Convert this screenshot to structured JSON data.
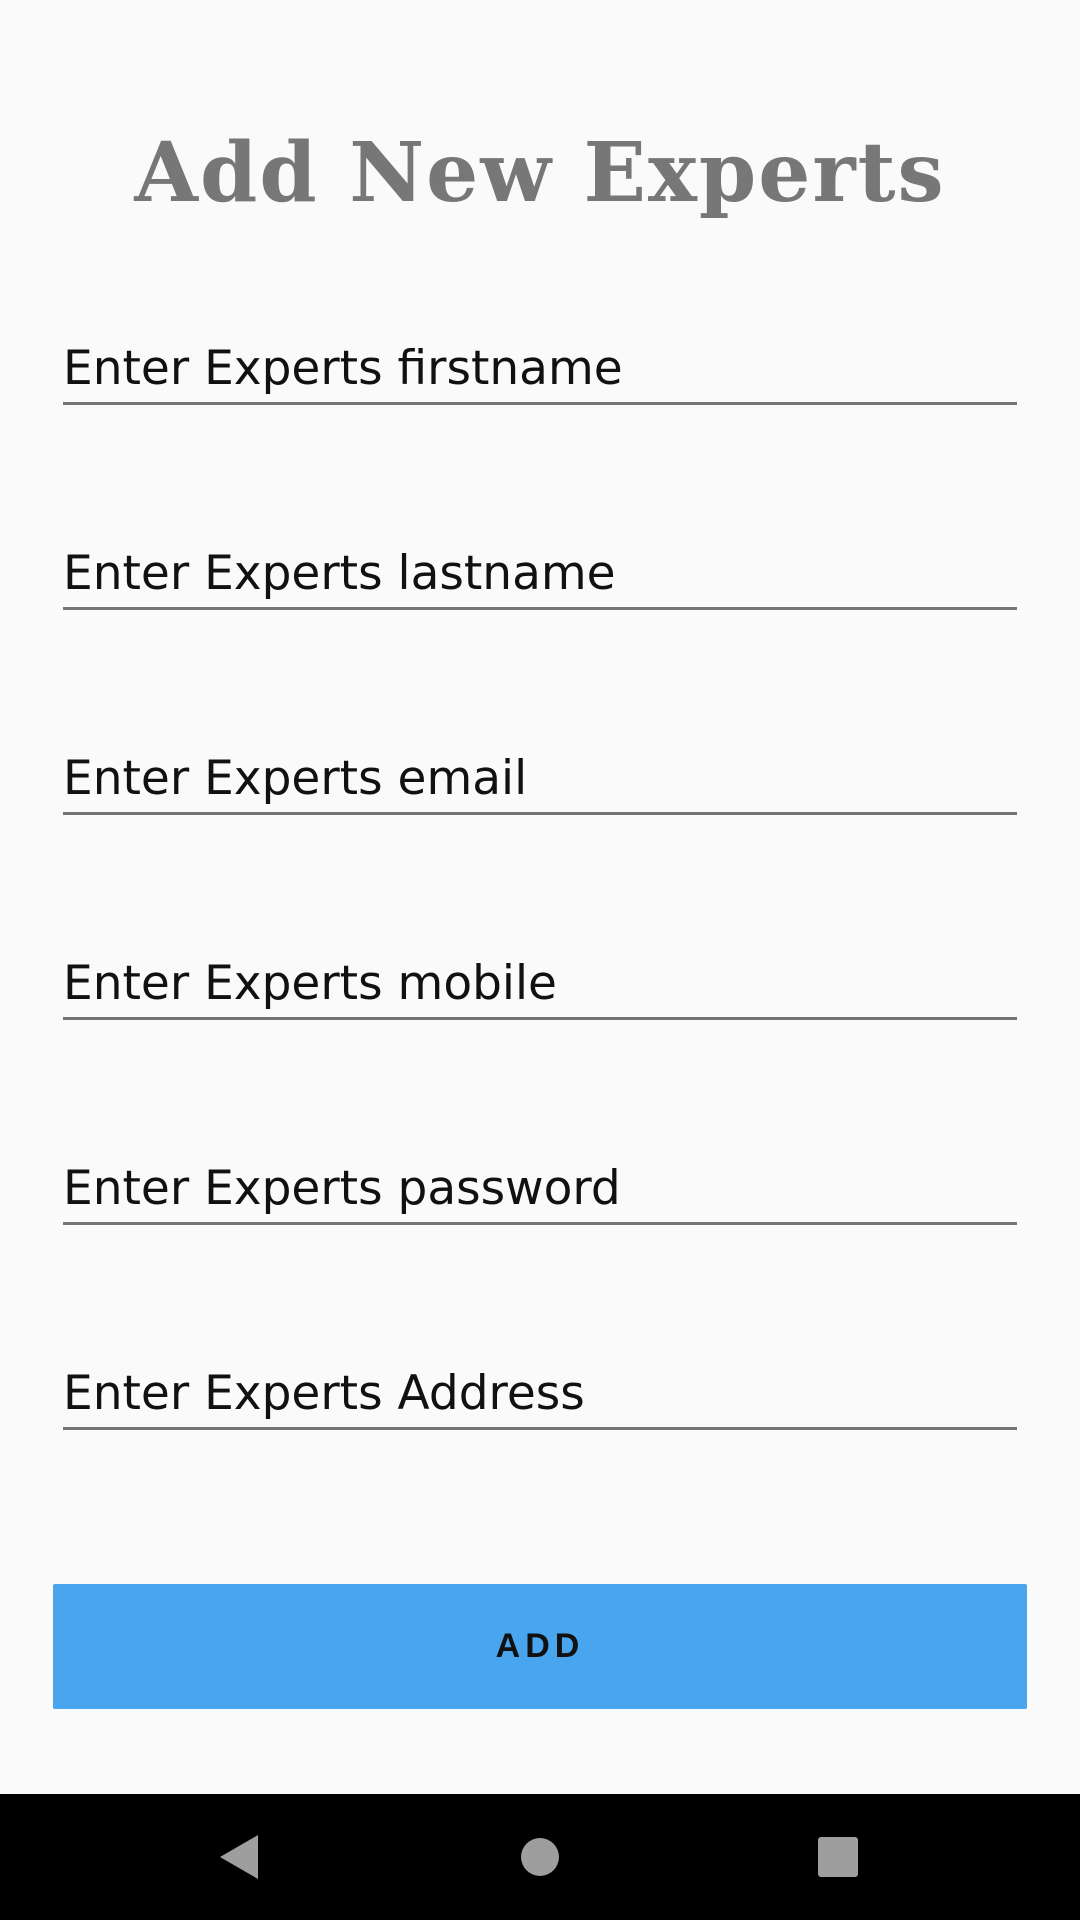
{
  "page": {
    "title": "Add New Experts"
  },
  "form": {
    "fields": [
      {
        "placeholder": "Enter Experts firstname",
        "value": ""
      },
      {
        "placeholder": "Enter Experts lastname",
        "value": ""
      },
      {
        "placeholder": "Enter Experts email",
        "value": ""
      },
      {
        "placeholder": "Enter Experts mobile",
        "value": ""
      },
      {
        "placeholder": "Enter Experts password",
        "value": ""
      },
      {
        "placeholder": "Enter Experts Address",
        "value": ""
      }
    ],
    "submit_label": "ADD"
  },
  "colors": {
    "button_bg": "#49a5ee",
    "title_text": "#777777",
    "underline": "#757575",
    "navbar_bg": "#000000"
  },
  "navbar": {
    "back_icon": "back-triangle-icon",
    "home_icon": "home-circle-icon",
    "recent_icon": "recents-square-icon"
  }
}
